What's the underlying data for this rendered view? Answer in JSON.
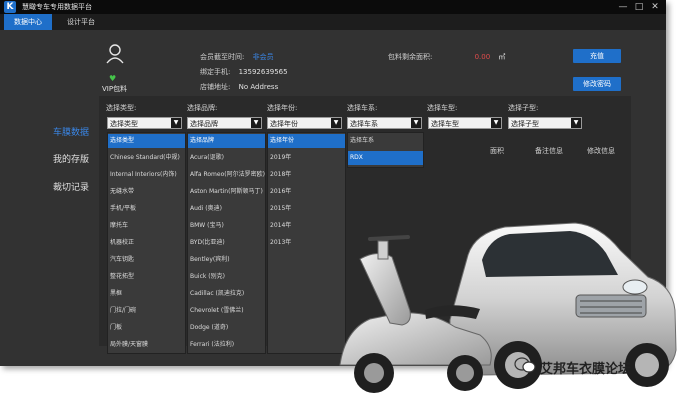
{
  "window": {
    "title": "慧瞰专车专用数据平台",
    "logo_text": "K"
  },
  "tabs": [
    {
      "label": "数据中心"
    },
    {
      "label": "设计平台"
    }
  ],
  "account": {
    "vip_label": "VIP包料",
    "expire_label": "会员截至时间:",
    "expire_value": "非会员",
    "phone_label": "绑定手机:",
    "phone_value": "13592639565",
    "address_label": "店铺地址:",
    "address_value": "No Address",
    "remaining_label": "包料剩余面积:",
    "remaining_value": "0.00",
    "remaining_unit": "㎡"
  },
  "buttons": {
    "recharge": "充值",
    "change_password": "修改密码"
  },
  "sidebar": {
    "items": [
      {
        "label": "车膜数据"
      },
      {
        "label": "我的存版"
      },
      {
        "label": "裁切记录"
      }
    ]
  },
  "filters": [
    {
      "label": "选择类型:",
      "value": "选择类型"
    },
    {
      "label": "选择品牌:",
      "value": "选择品牌"
    },
    {
      "label": "选择年份:",
      "value": "选择年份"
    },
    {
      "label": "选择车系:",
      "value": "选择车系"
    },
    {
      "label": "选择车型:",
      "value": "选择车型"
    },
    {
      "label": "选择子型:",
      "value": "选择子型"
    }
  ],
  "table_headers": {
    "area": "面积",
    "remark": "备注信息",
    "modify": "修改信息"
  },
  "dropdowns": {
    "type": [
      "选择类型",
      "Chinese Standard(中规)",
      "Internal Interiors(内饰)",
      "无缝水带",
      "手机/平板",
      "摩托车",
      "机器校正",
      "汽车钥匙",
      "整花拓型",
      "黑框",
      "门拉/门碗",
      "门板",
      "局外膜/天窗膜"
    ],
    "brand": [
      "选择品牌",
      "Acura(讴歌)",
      "Alfa Romeo(阿尔法罗密欧)",
      "Aston Martin(阿斯顿马丁)",
      "Audi (奥迪)",
      "BMW (宝马)",
      "BYD(比亚迪)",
      "Bentley(宾利)",
      "Buick (别克)",
      "Cadillac (凯迪拉克)",
      "Chevrolet (雪佛兰)",
      "Dodge (道奇)",
      "Ferrari (法拉利)"
    ],
    "year": [
      "选择年份",
      "2019年",
      "2018年",
      "2016年",
      "2015年",
      "2014年",
      "2013年"
    ],
    "series": [
      "选择车系",
      "RDX"
    ]
  },
  "watermark": {
    "text": "艾邦车衣膜论坛"
  },
  "colors": {
    "accent": "#1f6fc9",
    "window_bg": "#323232",
    "titlebar": "#0b0b0b"
  }
}
